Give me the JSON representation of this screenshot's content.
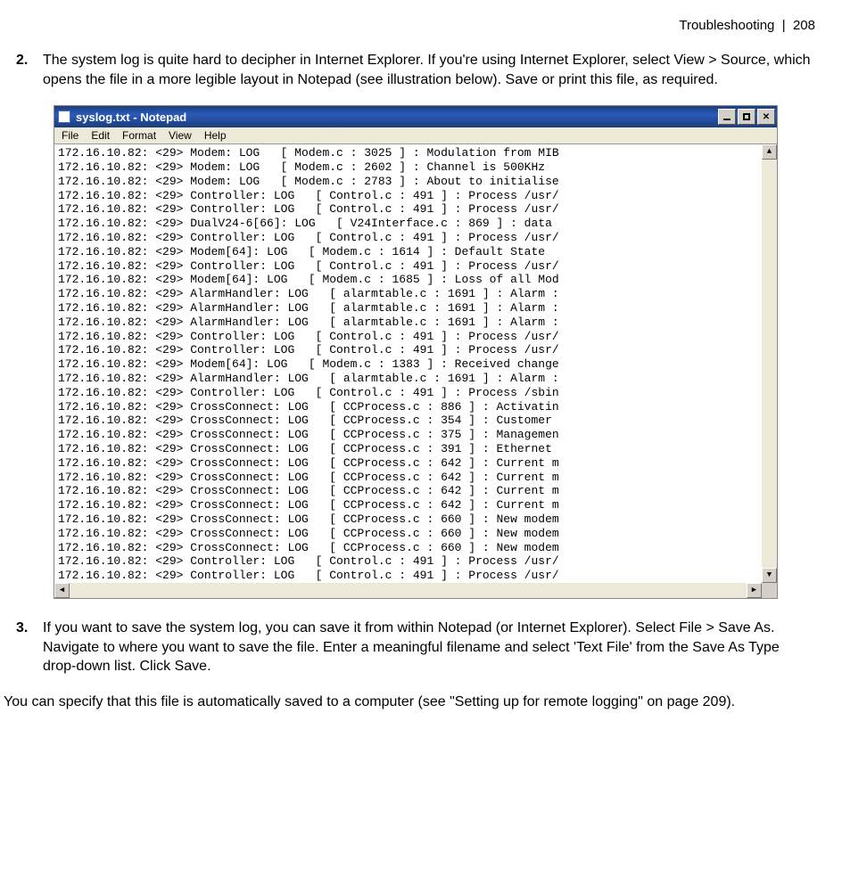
{
  "header": {
    "section": "Troubleshooting",
    "sep": "|",
    "page": "208"
  },
  "step2": {
    "num": "2.",
    "text": "The system log is quite hard to decipher in Internet Explorer. If you're using Internet Explorer, select View > Source, which opens the file in a more legible layout in Notepad (see illustration below). Save or print this file, as required."
  },
  "step3": {
    "num": "3.",
    "text": "If you want to save the system log, you can save it from within Notepad (or Internet Explorer). Select File > Save As. Navigate to where you want to save the file. Enter a meaningful filename and select 'Text File' from the Save As Type drop-down list. Click Save."
  },
  "footer_para": "You can specify that this file is automatically saved to a computer (see \"Setting up for remote logging\" on page 209).",
  "window": {
    "title": "syslog.txt - Notepad",
    "menus": [
      "File",
      "Edit",
      "Format",
      "View",
      "Help"
    ]
  },
  "log_lines": [
    "172.16.10.82: <29> Modem: LOG   [ Modem.c : 3025 ] : Modulation from MIB",
    "172.16.10.82: <29> Modem: LOG   [ Modem.c : 2602 ] : Channel is 500KHz",
    "172.16.10.82: <29> Modem: LOG   [ Modem.c : 2783 ] : About to initialise",
    "172.16.10.82: <29> Controller: LOG   [ Control.c : 491 ] : Process /usr/",
    "172.16.10.82: <29> Controller: LOG   [ Control.c : 491 ] : Process /usr/",
    "172.16.10.82: <29> DualV24-6[66]: LOG   [ V24Interface.c : 869 ] : data",
    "172.16.10.82: <29> Controller: LOG   [ Control.c : 491 ] : Process /usr/",
    "172.16.10.82: <29> Modem[64]: LOG   [ Modem.c : 1614 ] : Default State",
    "172.16.10.82: <29> Controller: LOG   [ Control.c : 491 ] : Process /usr/",
    "172.16.10.82: <29> Modem[64]: LOG   [ Modem.c : 1685 ] : Loss of all Mod",
    "172.16.10.82: <29> AlarmHandler: LOG   [ alarmtable.c : 1691 ] : Alarm :",
    "172.16.10.82: <29> AlarmHandler: LOG   [ alarmtable.c : 1691 ] : Alarm :",
    "172.16.10.82: <29> AlarmHandler: LOG   [ alarmtable.c : 1691 ] : Alarm :",
    "172.16.10.82: <29> Controller: LOG   [ Control.c : 491 ] : Process /usr/",
    "172.16.10.82: <29> Controller: LOG   [ Control.c : 491 ] : Process /usr/",
    "172.16.10.82: <29> Modem[64]: LOG   [ Modem.c : 1383 ] : Received change",
    "172.16.10.82: <29> AlarmHandler: LOG   [ alarmtable.c : 1691 ] : Alarm :",
    "172.16.10.82: <29> Controller: LOG   [ Control.c : 491 ] : Process /sbin",
    "172.16.10.82: <29> CrossConnect: LOG   [ CCProcess.c : 886 ] : Activatin",
    "172.16.10.82: <29> CrossConnect: LOG   [ CCProcess.c : 354 ] : Customer",
    "172.16.10.82: <29> CrossConnect: LOG   [ CCProcess.c : 375 ] : Managemen",
    "172.16.10.82: <29> CrossConnect: LOG   [ CCProcess.c : 391 ] : Ethernet",
    "172.16.10.82: <29> CrossConnect: LOG   [ CCProcess.c : 642 ] : Current m",
    "172.16.10.82: <29> CrossConnect: LOG   [ CCProcess.c : 642 ] : Current m",
    "172.16.10.82: <29> CrossConnect: LOG   [ CCProcess.c : 642 ] : Current m",
    "172.16.10.82: <29> CrossConnect: LOG   [ CCProcess.c : 642 ] : Current m",
    "172.16.10.82: <29> CrossConnect: LOG   [ CCProcess.c : 660 ] : New modem",
    "172.16.10.82: <29> CrossConnect: LOG   [ CCProcess.c : 660 ] : New modem",
    "172.16.10.82: <29> CrossConnect: LOG   [ CCProcess.c : 660 ] : New modem",
    "172.16.10.82: <29> Controller: LOG   [ Control.c : 491 ] : Process /usr/",
    "172.16.10.82: <29> Controller: LOG   [ Control.c : 491 ] : Process /usr/"
  ]
}
